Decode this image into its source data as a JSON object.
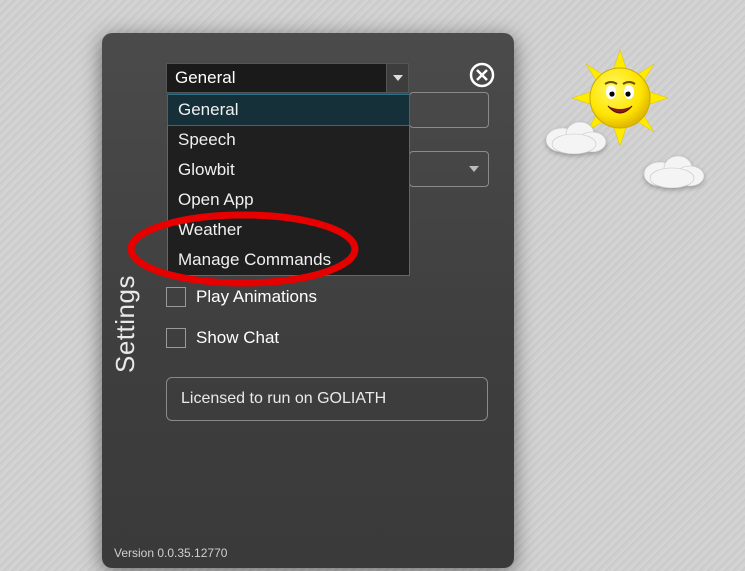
{
  "panel": {
    "title": "Settings",
    "version_label": "Version 0.0.35.12770"
  },
  "dropdown": {
    "selected": "General",
    "options": [
      "General",
      "Speech",
      "Glowbit",
      "Open App",
      "Weather",
      "Manage Commands"
    ]
  },
  "checkboxes": {
    "play_animations": "Play Animations",
    "show_chat": "Show Chat"
  },
  "license": {
    "text": "Licensed to run on GOLIATH"
  }
}
